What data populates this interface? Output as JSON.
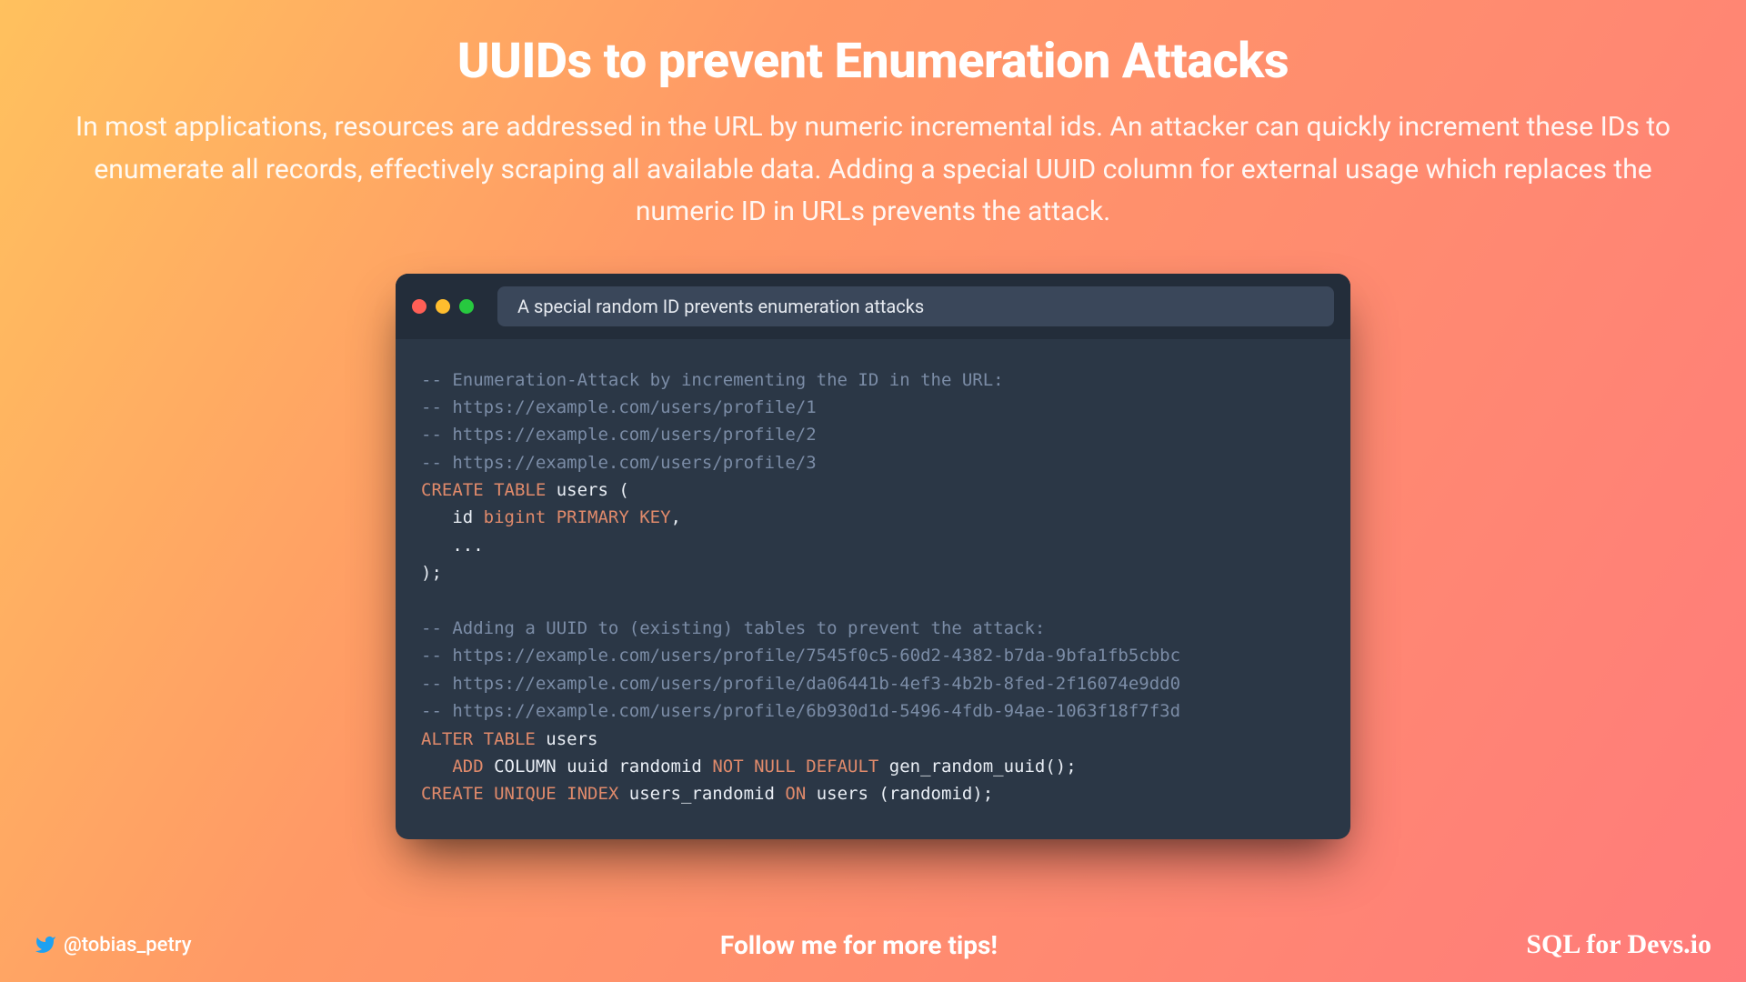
{
  "title": "UUIDs to prevent Enumeration Attacks",
  "subtitle": "In most applications, resources are addressed in the URL by numeric incremental ids. An attacker can quickly increment these IDs to enumerate all records, effectively scraping all available data. Adding a special UUID column for external usage which replaces the numeric ID in URLs prevents the attack.",
  "terminal": {
    "tab_title": "A special random ID prevents enumeration attacks",
    "code": {
      "c1": "-- Enumeration-Attack by incrementing the ID in the URL:",
      "c2": "-- https://example.com/users/profile/1",
      "c3": "-- https://example.com/users/profile/2",
      "c4": "-- https://example.com/users/profile/3",
      "l5a": "CREATE TABLE",
      "l5b": " users (",
      "l6a": "   id ",
      "l6b": "bigint PRIMARY KEY",
      "l6c": ",",
      "l7": "   ...",
      "l8": ");",
      "blank": "",
      "c9": "-- Adding a UUID to (existing) tables to prevent the attack:",
      "c10": "-- https://example.com/users/profile/7545f0c5-60d2-4382-b7da-9bfa1fb5cbbc",
      "c11": "-- https://example.com/users/profile/da06441b-4ef3-4b2b-8fed-2f16074e9dd0",
      "c12": "-- https://example.com/users/profile/6b930d1d-5496-4fdb-94ae-1063f18f7f3d",
      "l13a": "ALTER TABLE",
      "l13b": " users",
      "l14a": "   ADD",
      "l14b": " COLUMN uuid randomid ",
      "l14c": "NOT NULL DEFAULT",
      "l14d": " gen_random_uuid();",
      "l15a": "CREATE UNIQUE INDEX",
      "l15b": " users_randomid ",
      "l15c": "ON",
      "l15d": " users (randomid);"
    }
  },
  "footer": {
    "handle": "@tobias_petry",
    "cta": "Follow me for more tips!",
    "brand": "SQL for Devs.io"
  }
}
